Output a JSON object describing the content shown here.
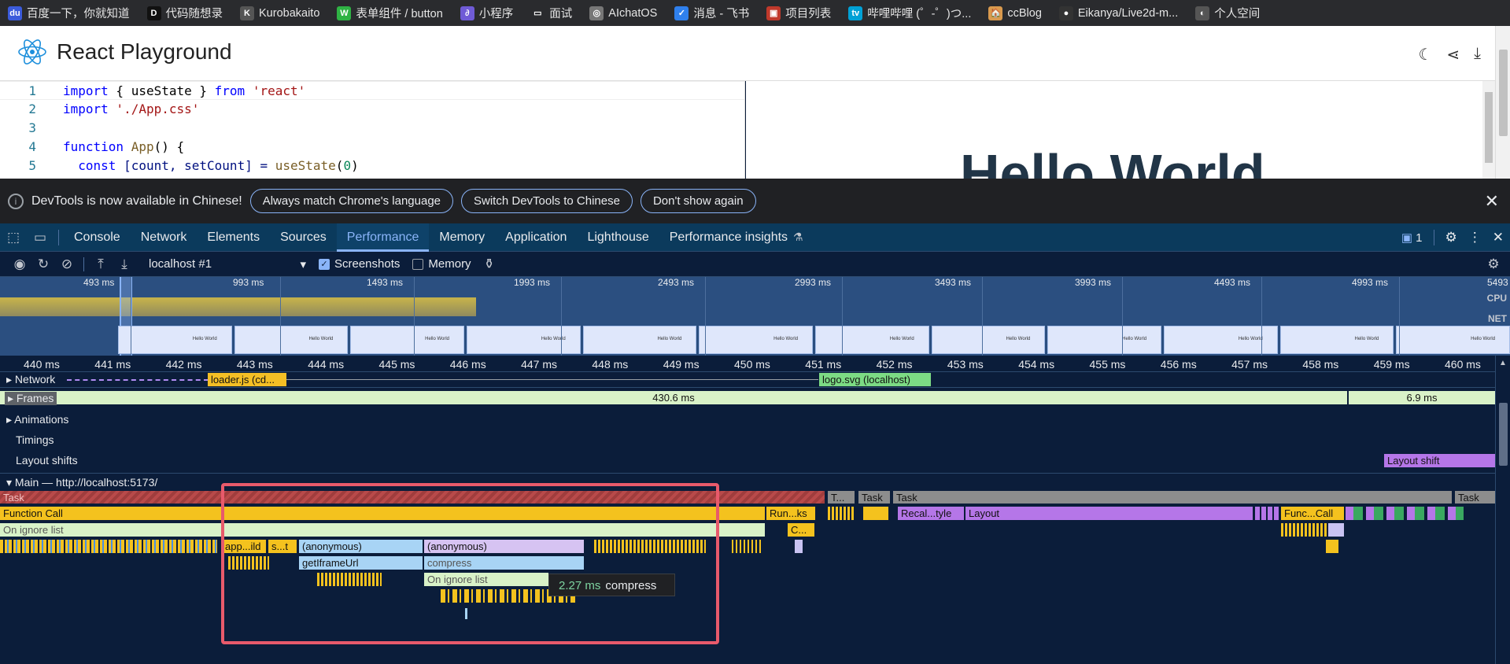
{
  "bookmarks": [
    {
      "label": "百度一下，你就知道",
      "color": "#3b5bdb",
      "glyph": "du"
    },
    {
      "label": "代码随想录",
      "color": "#111111",
      "glyph": "D"
    },
    {
      "label": "Kurobakaito",
      "color": "#555555",
      "glyph": "K"
    },
    {
      "label": "表单组件 / button",
      "color": "#2fb344",
      "glyph": "W"
    },
    {
      "label": "小程序",
      "color": "#6f5bd6",
      "glyph": "∂"
    },
    {
      "label": "面试",
      "color": "#2a2b2e",
      "glyph": "▭"
    },
    {
      "label": "AIchatOS",
      "color": "#777777",
      "glyph": "◎"
    },
    {
      "label": "消息 - 飞书",
      "color": "#2f80ed",
      "glyph": "✓"
    },
    {
      "label": "项目列表",
      "color": "#c0392b",
      "glyph": "▣"
    },
    {
      "label": "哔哩哔哩 (゜-゜)つ...",
      "color": "#00a1d6",
      "glyph": "tv"
    },
    {
      "label": "ccBlog",
      "color": "#d99a4e",
      "glyph": "🏠"
    },
    {
      "label": "Eikanya/Live2d-m...",
      "color": "#333333",
      "glyph": "●"
    },
    {
      "label": "个人空间",
      "color": "#555555",
      "glyph": "◐"
    }
  ],
  "app": {
    "title": "React Playground"
  },
  "editor": {
    "lines": [
      {
        "n": "1"
      },
      {
        "n": "2"
      },
      {
        "n": "3"
      },
      {
        "n": "4"
      },
      {
        "n": "5"
      }
    ],
    "code": {
      "l1_a": "import",
      "l1_b": " { useState } ",
      "l1_c": "from",
      "l1_d": " 'react'",
      "l2_a": "import",
      "l2_b": " './App.css'",
      "l4_a": "function",
      "l4_b": " App",
      "l4_c": "() {",
      "l5_a": "  const",
      "l5_b": " [count, setCount] = ",
      "l5_c": "useState",
      "l5_d": "(",
      "l5_e": "0",
      "l5_f": ")"
    }
  },
  "preview": {
    "heading": "Hello World"
  },
  "infobar": {
    "message": "DevTools is now available in Chinese!",
    "btn1": "Always match Chrome's language",
    "btn2": "Switch DevTools to Chinese",
    "btn3": "Don't show again"
  },
  "devtools": {
    "tabs": [
      "Console",
      "Network",
      "Elements",
      "Sources",
      "Performance",
      "Memory",
      "Application",
      "Lighthouse",
      "Performance insights"
    ],
    "active_tab": "Performance",
    "issues_count": "1",
    "target": "localhost #1",
    "screenshots_label": "Screenshots",
    "memory_label": "Memory"
  },
  "overview": {
    "labels": [
      "493 ms",
      "993 ms",
      "1493 ms",
      "1993 ms",
      "2493 ms",
      "2993 ms",
      "3493 ms",
      "3993 ms",
      "4493 ms",
      "4993 ms",
      "5493"
    ],
    "cpu_label": "CPU",
    "net_label": "NET",
    "shot_text": "Hello World"
  },
  "ruler": [
    "440 ms",
    "441 ms",
    "442 ms",
    "443 ms",
    "444 ms",
    "445 ms",
    "446 ms",
    "447 ms",
    "448 ms",
    "449 ms",
    "450 ms",
    "451 ms",
    "452 ms",
    "453 ms",
    "454 ms",
    "455 ms",
    "456 ms",
    "457 ms",
    "458 ms",
    "459 ms",
    "460 ms"
  ],
  "tracks": {
    "network": "Network",
    "network_items": [
      "loader.js (cd...",
      "logo.svg (localhost)"
    ],
    "frames": "Frames",
    "frame_values": [
      "430.6 ms",
      "6.9 ms"
    ],
    "animations": "Animations",
    "timings": "Timings",
    "layout_shifts": "Layout shifts",
    "layout_shift_item": "Layout shift",
    "main": "Main — http://localhost:5173/"
  },
  "flame": {
    "task": "Task",
    "t_short": "T...",
    "function_call": "Function Call",
    "run_ks": "Run...ks",
    "recalc": "Recal...tyle",
    "layout": "Layout",
    "func_call_short": "Func...Call",
    "c_short": "C...",
    "ignore": "On ignore list",
    "app_ild": "app...ild",
    "s_t": "s...t",
    "anon1": "(anonymous)",
    "anon2": "(anonymous)",
    "getiframe": "getIframeUrl",
    "compress": "compress",
    "ignore2": "On ignore list"
  },
  "tooltip": {
    "time": "2.27 ms",
    "name": "compress"
  }
}
